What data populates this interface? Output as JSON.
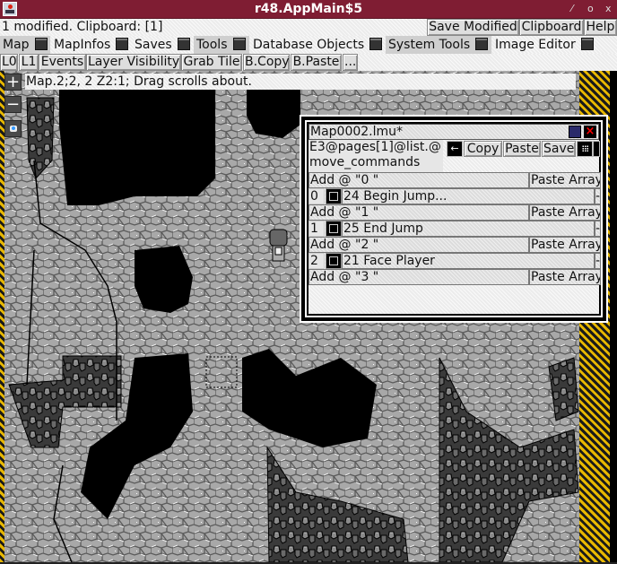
{
  "window": {
    "title": "r48.AppMain$5",
    "controls": {
      "minimize": "⁄",
      "maximize": "o",
      "close": "x"
    }
  },
  "statusbar": {
    "text": "1 modified. Clipboard: [1]",
    "buttons": {
      "save_modified": "Save Modified",
      "clipboard": "Clipboard",
      "help": "Help"
    }
  },
  "tabs": [
    {
      "label": "Map",
      "selected": true
    },
    {
      "label": "MapInfos",
      "selected": false
    },
    {
      "label": "Saves",
      "selected": false
    },
    {
      "label": "Tools",
      "selected": true
    },
    {
      "label": "Database Objects",
      "selected": false
    },
    {
      "label": "System Tools",
      "selected": true
    },
    {
      "label": "Image Editor",
      "selected": false
    }
  ],
  "toolbar": {
    "buttons": [
      "L0",
      "L1",
      "Events",
      "Layer Visibility",
      "Grab Tile",
      "B.Copy",
      "B.Paste",
      "..."
    ]
  },
  "map": {
    "hint": "Map.2;2, 2 Z2:1; Drag scrolls about.",
    "zoom_in": "+",
    "zoom_out": "−",
    "colors": {
      "floor": "#a8a8a8",
      "void": "#000000",
      "stripe": "#e8b800"
    }
  },
  "panel": {
    "title": "Map0002.lmu*",
    "path_line1": "E3@pages[1]@list.@",
    "path_line2": "move_commands",
    "buttons": {
      "back": "←",
      "copy": "Copy",
      "paste": "Paste",
      "save": "Save"
    },
    "colors": {
      "folder": "#2a2a6a",
      "close": "#ff0000"
    },
    "entries": [
      {
        "add": "Add @ \"0 \"",
        "paste_array": "Paste Array",
        "index": "0",
        "command": "24 Begin Jump...",
        "remove": "-"
      },
      {
        "add": "Add @ \"1 \"",
        "paste_array": "Paste Array",
        "index": "1",
        "command": "25 End Jump",
        "remove": "-"
      },
      {
        "add": "Add @ \"2 \"",
        "paste_array": "Paste Array",
        "index": "2",
        "command": "21 Face Player",
        "remove": "-"
      }
    ],
    "final_add": {
      "add": "Add @ \"3 \"",
      "paste_array": "Paste Array"
    }
  }
}
